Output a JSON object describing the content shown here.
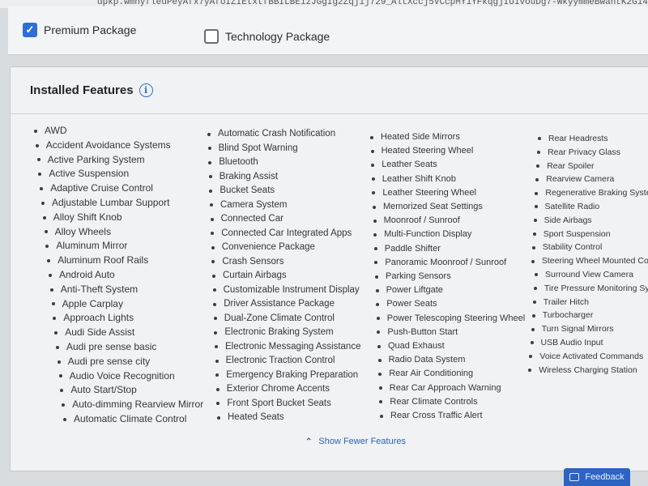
{
  "url_fragment": "dpkp.wmhyfleuPeyAfx7yAfoIZIEtxtfBBILBE1zJGgIg2Zqjij729_AltXccj5VCcpMY1YFkqgjIUivouDg7-WkyymmeBwantK2Gi4",
  "packages": [
    {
      "label": "Premium Package",
      "checked": true
    },
    {
      "label": "Technology Package",
      "checked": false
    }
  ],
  "features": {
    "title": "Installed Features",
    "columns": [
      [
        "AWD",
        "Accident Avoidance Systems",
        "Active Parking System",
        "Active Suspension",
        "Adaptive Cruise Control",
        "Adjustable Lumbar Support",
        "Alloy Shift Knob",
        "Alloy Wheels",
        "Aluminum Mirror",
        "Aluminum Roof Rails",
        "Android Auto",
        "Anti-Theft System",
        "Apple Carplay",
        "Approach Lights",
        "Audi Side Assist",
        "Audi pre sense basic",
        "Audi pre sense city",
        "Audio Voice Recognition",
        "Auto Start/Stop",
        "Auto-dimming Rearview Mirror",
        "Automatic Climate Control"
      ],
      [
        "Automatic Crash Notification",
        "Blind Spot Warning",
        "Bluetooth",
        "Braking Assist",
        "Bucket Seats",
        "Camera System",
        "Connected Car",
        "Connected Car Integrated Apps",
        "Convenience Package",
        "Crash Sensors",
        "Curtain Airbags",
        "Customizable Instrument Display",
        "Driver Assistance Package",
        "Dual-Zone Climate Control",
        "Electronic Braking System",
        "Electronic Messaging Assistance",
        "Electronic Traction Control",
        "Emergency Braking Preparation",
        "Exterior Chrome Accents",
        "Front Sport Bucket Seats",
        "Heated Seats"
      ],
      [
        "Heated Side Mirrors",
        "Heated Steering Wheel",
        "Leather Seats",
        "Leather Shift Knob",
        "Leather Steering Wheel",
        "Memorized Seat Settings",
        "Moonroof / Sunroof",
        "Multi-Function Display",
        "Paddle Shifter",
        "Panoramic Moonroof / Sunroof",
        "Parking Sensors",
        "Power Liftgate",
        "Power Seats",
        "Power Telescoping Steering Wheel",
        "Push-Button Start",
        "Quad Exhaust",
        "Radio Data System",
        "Rear Air Conditioning",
        "Rear Car Approach Warning",
        "Rear Climate Controls",
        "Rear Cross Traffic Alert"
      ],
      [
        "Rear Headrests",
        "Rear Privacy Glass",
        "Rear Spoiler",
        "Rearview Camera",
        "Regenerative Braking System",
        "Satellite Radio",
        "Side Airbags",
        "Sport Suspension",
        "Stability Control",
        "Steering Wheel Mounted Controls",
        "Surround View Camera",
        "Tire Pressure Monitoring System",
        "Trailer Hitch",
        "Turbocharger",
        "Turn Signal Mirrors",
        "USB Audio Input",
        "Voice Activated Commands",
        "Wireless Charging Station"
      ]
    ],
    "show_fewer_label": "Show Fewer Features"
  },
  "feedback_label": "Feedback",
  "colors": {
    "accent": "#2e6fd6",
    "link": "#2d62b8",
    "feedback_bg": "#2c64c4"
  }
}
